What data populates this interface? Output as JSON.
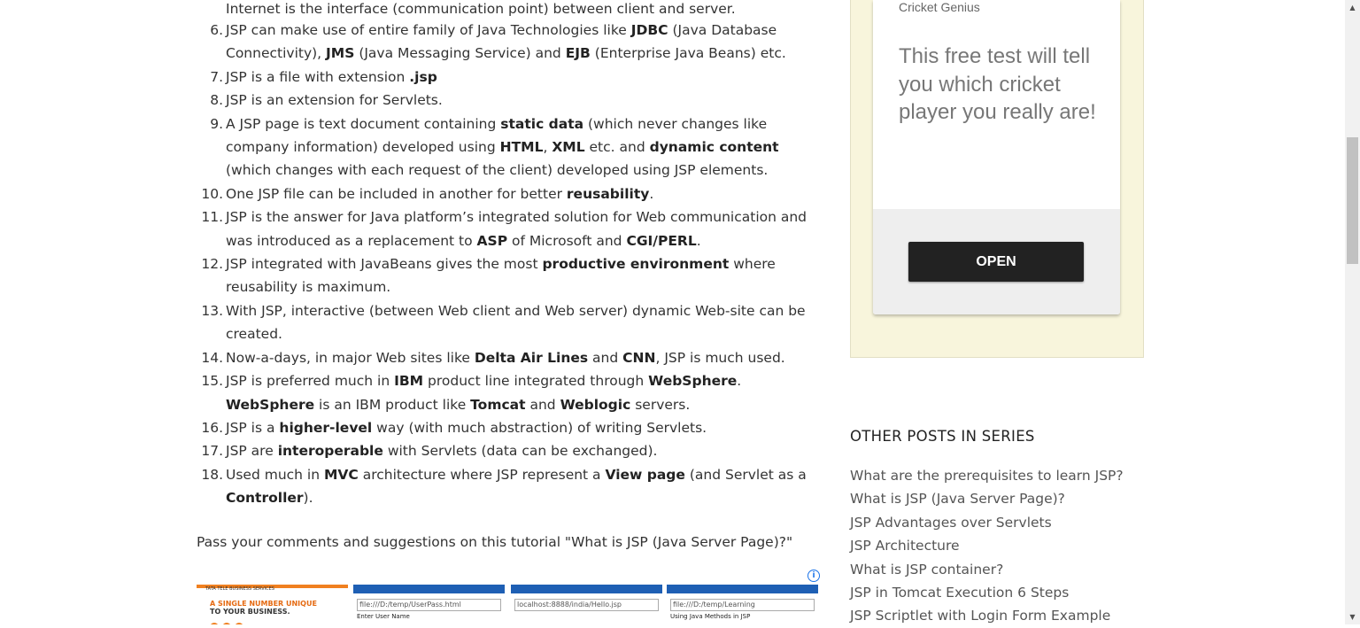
{
  "article": {
    "intro_line": "Internet is the interface (communication point) between client and server.",
    "points": [
      {
        "num": "6.",
        "html": "JSP can make use of entire family of Java Technologies like <b>JDBC</b> (Java Database Connectivity), <b>JMS</b> (Java Messaging Service) and <b>EJB</b> (Enterprise Java Beans) etc."
      },
      {
        "num": "7.",
        "html": "JSP is a file with extension <b>.jsp</b>"
      },
      {
        "num": "8.",
        "html": "JSP is an extension for Servlets."
      },
      {
        "num": "9.",
        "html": "A JSP page is text document containing <b>static data</b> (which never changes like company information) developed using <b>HTML</b>, <b>XML</b> etc. and <b>dynamic content</b> (which changes with each request of the client) developed using JSP elements."
      },
      {
        "num": "10.",
        "html": "One JSP file can be included in another for better <b>reusability</b>."
      },
      {
        "num": "11.",
        "html": "JSP is the answer for Java platform’s integrated solution for Web communication and was introduced as a replacement to <b>ASP</b> of Microsoft and <b>CGI/PERL</b>."
      },
      {
        "num": "12.",
        "html": "JSP integrated with JavaBeans gives the most <b>productive environment</b> where reusability is maximum."
      },
      {
        "num": "13.",
        "html": "With JSP, interactive (between Web client and Web server) dynamic Web-site can be created."
      },
      {
        "num": "14.",
        "html": "Now-a-days, in major Web sites like <b>Delta Air Lines</b> and <b>CNN</b>, JSP is much used."
      },
      {
        "num": "15.",
        "html": "JSP is preferred much in <b>IBM</b> product line integrated through <b>WebSphere</b>. <b>WebSphere</b> is an IBM product like <b>Tomcat</b> and <b>Weblogic</b> servers."
      },
      {
        "num": "16.",
        "html": "JSP is a <b>higher-level</b> way (with much abstraction) of writing Servlets."
      },
      {
        "num": "17.",
        "html": "JSP are <b>interoperable</b> with Servlets (data can be exchanged)."
      },
      {
        "num": "18.",
        "html": "Used much in <b>MVC</b> architecture where JSP represent a <b>View page</b> (and Servlet as a <b>Controller</b>)."
      }
    ],
    "pass_comments": "Pass your comments and suggestions on this tutorial \"What is JSP (Java Server Page)?\""
  },
  "thumbnails": {
    "t1_small": "TATA TELE BUSINESS SERVICES",
    "t1_head": "A SINGLE NUMBER UNIQUE",
    "t1_head2": "TO YOUR BUSINESS.",
    "t2_addr": "file:///D:/temp/UserPass.html",
    "t2_body": "Enter User Name",
    "t3_addr": "localhost:8888/india/Hello.jsp",
    "t4_addr": "file:///D:/temp/Learning",
    "t4_body": "Using Java Methods in JSP"
  },
  "ad": {
    "info_icon": "i",
    "brand": "Cricket Genius",
    "text": "This free test will tell you which cricket player you really are!",
    "button": "OPEN",
    "colors": {
      "background": "#f8f5dc",
      "button": "#222222"
    }
  },
  "sidebar": {
    "title": "OTHER POSTS IN SERIES",
    "posts": [
      "What are the prerequisites to learn JSP?",
      "What is JSP (Java Server Page)?",
      "JSP Advantages over Servlets",
      "JSP Architecture",
      "What is JSP container?",
      "JSP in Tomcat Execution 6 Steps",
      "JSP Scriptlet with Login Form Example"
    ]
  },
  "scrollbar": {
    "up": "▲",
    "down": "▼"
  }
}
